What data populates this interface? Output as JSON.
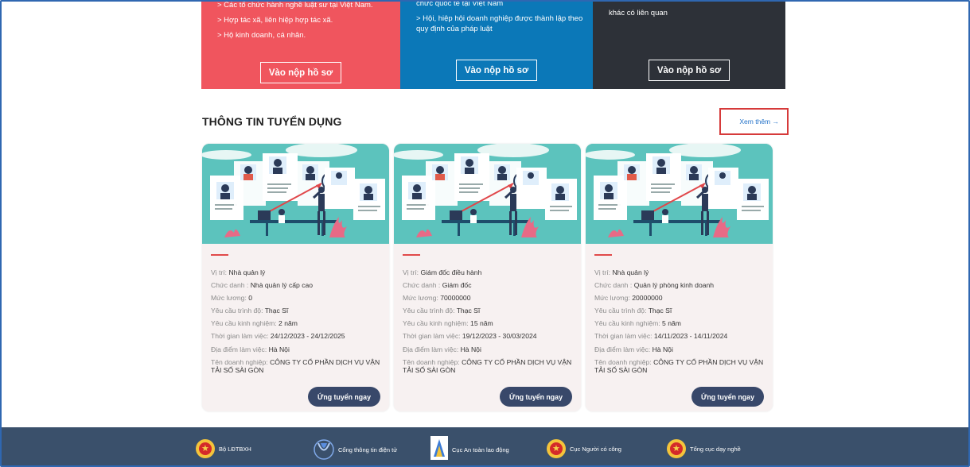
{
  "panels": {
    "red": {
      "items": [
        "> Các tổ chức hành nghề luật sư tại Việt Nam.",
        "> Hợp tác xã, liên hiệp hợp tác xã.",
        "> Hộ kinh doanh, cá nhân."
      ],
      "button": "Vào nộp hồ sơ"
    },
    "blue": {
      "items": [
        "chức quốc tế tại Việt Nam",
        "> Hội, hiệp hội doanh nghiệp được thành lập theo quy định của pháp luật"
      ],
      "button": "Vào nộp hồ sơ"
    },
    "dark": {
      "items": [
        "khác có liên quan"
      ],
      "button": "Vào nộp hồ sơ"
    }
  },
  "section": {
    "title": "THÔNG TIN TUYỂN DỤNG",
    "see_more": "Xem thêm →"
  },
  "cards": [
    {
      "rows": [
        {
          "label": "Vị trí: ",
          "value": "Nhà quản lý"
        },
        {
          "label": "Chức danh : ",
          "value": "Nhà quản lý cấp cao"
        },
        {
          "label": "Mức lương: ",
          "value": "0"
        },
        {
          "label": "Yêu cầu trình độ: ",
          "value": "Thạc Sĩ"
        },
        {
          "label": "Yêu cầu kinh nghiệm: ",
          "value": "2 năm"
        },
        {
          "label": "Thời gian làm việc: ",
          "value": "24/12/2023 - 24/12/2025"
        },
        {
          "label": "Địa điểm làm việc: ",
          "value": "Hà Nội"
        },
        {
          "label": "Tên doanh nghiệp: ",
          "value": "CÔNG TY CỔ PHẦN DỊCH VỤ VẬN TẢI SỐ SÀI GÒN"
        }
      ],
      "button": "Ứng tuyển ngay"
    },
    {
      "rows": [
        {
          "label": "Vị trí: ",
          "value": "Giám đốc điều hành"
        },
        {
          "label": "Chức danh : ",
          "value": "Giám đốc"
        },
        {
          "label": "Mức lương: ",
          "value": "70000000"
        },
        {
          "label": "Yêu cầu trình độ: ",
          "value": "Thạc Sĩ"
        },
        {
          "label": "Yêu cầu kinh nghiệm: ",
          "value": "15 năm"
        },
        {
          "label": "Thời gian làm việc: ",
          "value": "19/12/2023 - 30/03/2024"
        },
        {
          "label": "Địa điểm làm việc: ",
          "value": "Hà Nội"
        },
        {
          "label": "Tên doanh nghiệp: ",
          "value": "CÔNG TY CỔ PHẦN DỊCH VỤ VẬN TẢI SỐ SÀI GÒN"
        }
      ],
      "button": "Ứng tuyển ngay"
    },
    {
      "rows": [
        {
          "label": "Vị trí: ",
          "value": "Nhà quản lý"
        },
        {
          "label": "Chức danh : ",
          "value": "Quản lý phòng kinh doanh"
        },
        {
          "label": "Mức lương: ",
          "value": "20000000"
        },
        {
          "label": "Yêu cầu trình độ: ",
          "value": "Thạc Sĩ"
        },
        {
          "label": "Yêu cầu kinh nghiệm: ",
          "value": "5 năm"
        },
        {
          "label": "Thời gian làm việc: ",
          "value": "14/11/2023 - 14/11/2024"
        },
        {
          "label": "Địa điểm làm việc: ",
          "value": "Hà Nội"
        },
        {
          "label": "Tên doanh nghiệp: ",
          "value": "CÔNG TY CỔ PHẦN DỊCH VỤ VẬN TẢI SỐ SÀI GÒN"
        }
      ],
      "button": "Ứng tuyển ngay"
    }
  ],
  "footer": {
    "items": [
      {
        "label": "Bộ LĐTBXH",
        "icon": "national-emblem-icon"
      },
      {
        "label": "Cổng thông tin điện tử",
        "icon": "portal-logo-icon"
      },
      {
        "label": "Cục An toàn lao động",
        "icon": "labor-safety-logo-icon"
      },
      {
        "label": "Cục Người có công",
        "icon": "national-emblem-icon"
      },
      {
        "label": "Tổng cục dạy nghề",
        "icon": "national-emblem-icon"
      }
    ]
  },
  "colors": {
    "red_panel": "#f0555e",
    "blue_panel": "#0b78b8",
    "dark_panel": "#2d3138",
    "apply_button": "#38486a",
    "footer": "#3a506b",
    "link": "#2573c9",
    "highlight_border": "#d63a3a"
  }
}
